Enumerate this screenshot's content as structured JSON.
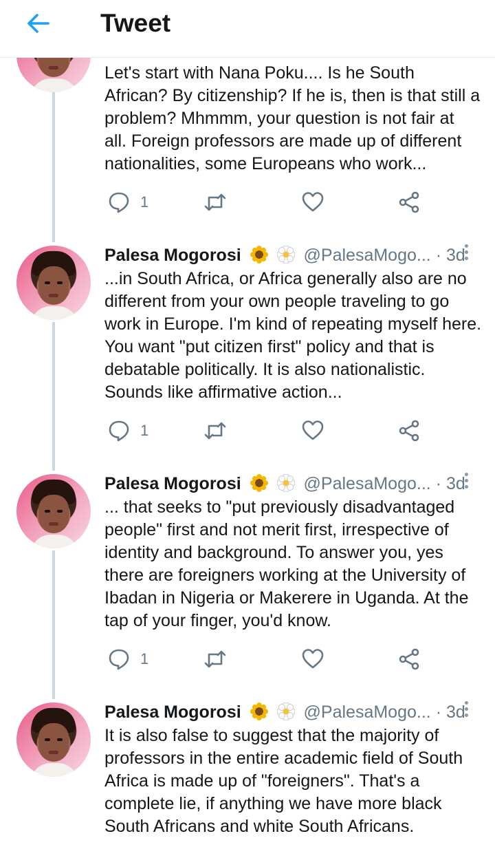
{
  "header": {
    "title": "Tweet"
  },
  "tweets": [
    {
      "text": "Let's start with Nana Poku.... Is he South\nAfrican? By citizenship? If he is, then is that still a\nproblem? Mhmmm, your question is not fair at\nall. Foreign professors are made up of different\nnationalities, some Europeans who work...",
      "reply_count": "1"
    },
    {
      "name": "Palesa Mogorosi",
      "handle": "@PalesaMogo...",
      "dot": "·",
      "time": "3d",
      "text": "...in South Africa, or Africa generally also are no\ndifferent from your own people traveling to go\nwork in Europe. I'm kind of repeating myself here.\nYou want \"put citizen first\" policy and that is\ndebatable politically. It is also nationalistic.\nSounds like affirmative action...",
      "reply_count": "1"
    },
    {
      "name": "Palesa Mogorosi",
      "handle": "@PalesaMogo...",
      "dot": "·",
      "time": "3d",
      "text": "... that seeks to \"put previously disadvantaged\npeople\" first and not merit first, irrespective of\nidentity and background. To answer you, yes\nthere are foreigners working at the University of\nIbadan in Nigeria or Makerere in Uganda. At the\ntap of your finger, you'd know.",
      "reply_count": "1"
    },
    {
      "name": "Palesa Mogorosi",
      "handle": "@PalesaMogo...",
      "dot": "·",
      "time": "3d",
      "text": "It is also false to suggest that the majority of\nprofessors in the entire academic field of South\nAfrica is made up of \"foreigners\". That's a\ncomplete lie, if anything we have more black\nSouth Africans and white South Africans."
    }
  ],
  "icons": {
    "back": "arrow-left-icon",
    "reply": "reply-icon",
    "retweet": "retweet-icon",
    "like": "heart-icon",
    "share": "share-icon",
    "more": "more-vertical-icon",
    "emoji": [
      "sunflower-icon",
      "blossom-icon"
    ]
  },
  "colors": {
    "accent": "#1da1f2",
    "icon_gray": "#657786",
    "thread_line": "#ccd6dd"
  }
}
